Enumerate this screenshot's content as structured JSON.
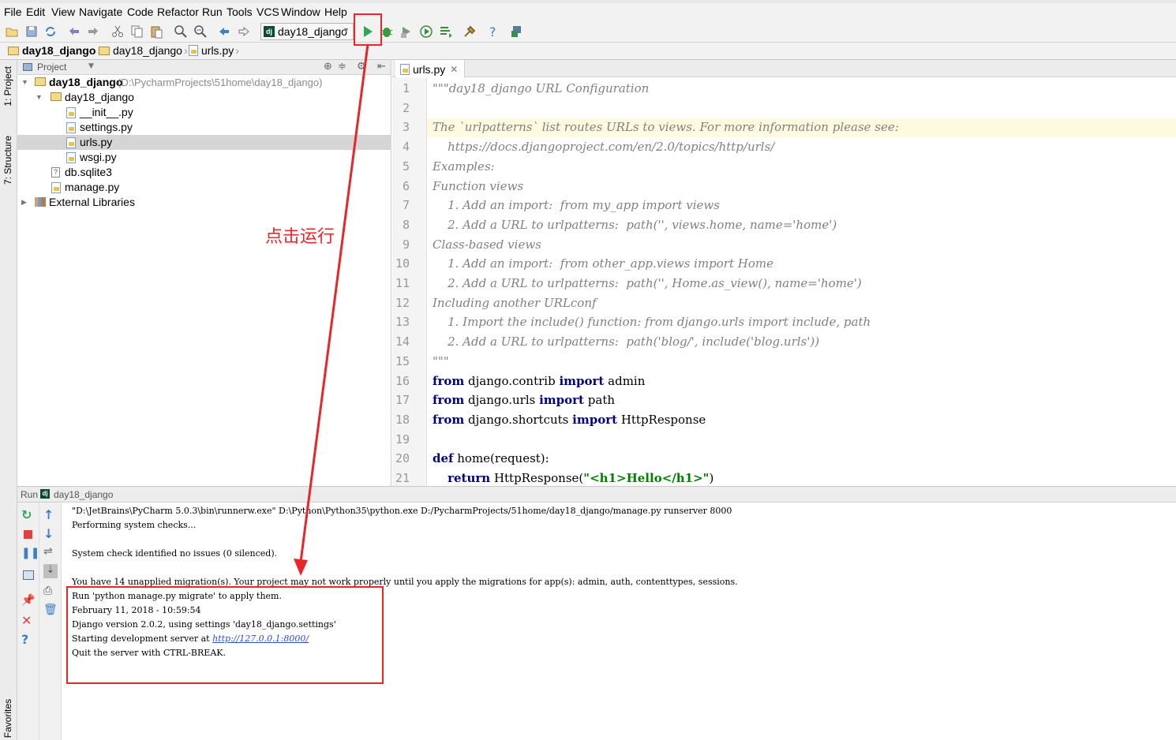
{
  "menu": [
    "File",
    "Edit",
    "View",
    "Navigate",
    "Code",
    "Refactor",
    "Run",
    "Tools",
    "VCS",
    "Window",
    "Help"
  ],
  "toolbar": {
    "run_config": "day18_django",
    "icons": [
      "open-folder-icon",
      "save-icon",
      "sync-icon",
      "undo-icon",
      "redo-icon",
      "cut-icon",
      "copy-icon",
      "paste-icon",
      "find-icon",
      "replace-icon",
      "back-icon",
      "forward-icon",
      "run-icon",
      "debug-icon",
      "coverage-icon",
      "profile-icon",
      "concurrency-icon",
      "settings-icon",
      "help-icon",
      "vcs-icon"
    ]
  },
  "breadcrumb": [
    "day18_django",
    "day18_django",
    "urls.py"
  ],
  "left_strip": {
    "project_tab": "1: Project",
    "structure_tab": "7: Structure",
    "favorites_tab": "Favorites"
  },
  "project_panel": {
    "title": "Project",
    "tree": [
      {
        "label": "day18_django",
        "extra": "(D:\\PycharmProjects\\51home\\day18_django)",
        "type": "folder"
      },
      {
        "label": "day18_django",
        "type": "folder"
      },
      {
        "label": "__init__.py",
        "type": "py"
      },
      {
        "label": "settings.py",
        "type": "py"
      },
      {
        "label": "urls.py",
        "type": "py",
        "selected": true
      },
      {
        "label": "wsgi.py",
        "type": "py"
      },
      {
        "label": "db.sqlite3",
        "type": "file"
      },
      {
        "label": "manage.py",
        "type": "py"
      },
      {
        "label": "External Libraries",
        "type": "lib"
      }
    ]
  },
  "editor": {
    "tab": "urls.py",
    "lines": [
      "\"\"\"day18_django URL Configuration",
      "",
      "The `urlpatterns` list routes URLs to views. For more information please see:",
      "    https://docs.djangoproject.com/en/2.0/topics/http/urls/",
      "Examples:",
      "Function views",
      "    1. Add an import:  from my_app import views",
      "    2. Add a URL to urlpatterns:  path('', views.home, name='home')",
      "Class-based views",
      "    1. Add an import:  from other_app.views import Home",
      "    2. Add a URL to urlpatterns:  path('', Home.as_view(), name='home')",
      "Including another URLconf",
      "    1. Import the include() function: from django.urls import include, path",
      "    2. Add a URL to urlpatterns:  path('blog/', include('blog.urls'))",
      "\"\"\"",
      "from django.contrib import admin",
      "from django.urls import path",
      "from django.shortcuts import HttpResponse",
      "",
      "def home(request):",
      "    return HttpResponse(\"<h1>Hello</h1>\")"
    ],
    "code": {
      "from": "from",
      "import": "import",
      "def": "def",
      "return": "return",
      "mod1": " django.contrib ",
      "name1": " admin",
      "mod2": " django.urls ",
      "name2": " path",
      "mod3": " django.shortcuts ",
      "name3": " HttpResponse",
      "func": " home(request):",
      "ret_call": " HttpResponse(",
      "ret_str": "\"<h1>Hello</h1>\"",
      "ret_close": ")"
    }
  },
  "run_panel": {
    "label": "Run",
    "config": "day18_django",
    "console": [
      "\"D:\\JetBrains\\PyCharm 5.0.3\\bin\\runnerw.exe\" D:\\Python\\Python35\\python.exe D:/PycharmProjects/51home/day18_django/manage.py runserver 8000",
      "Performing system checks...",
      "",
      "System check identified no issues (0 silenced).",
      "",
      "You have 14 unapplied migration(s). Your project may not work properly until you apply the migrations for app(s): admin, auth, contenttypes, sessions.",
      "Run 'python manage.py migrate' to apply them.",
      "February 11, 2018 - 10:59:54",
      "Django version 2.0.2, using settings 'day18_django.settings'",
      "Starting development server at ",
      "Quit the server with CTRL-BREAK."
    ],
    "server_url": "http://127.0.0.1:8000/"
  },
  "annotation": {
    "text": "点击运行",
    "color": "#e8262a"
  }
}
